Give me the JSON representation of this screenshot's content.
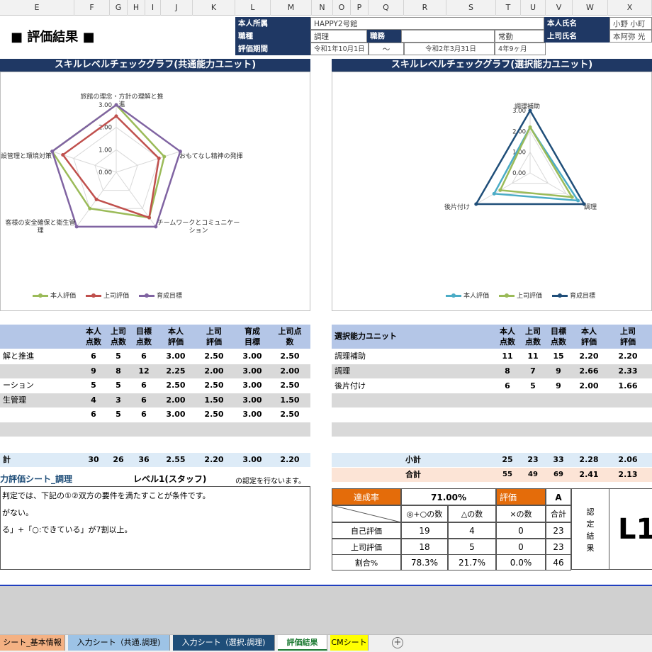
{
  "column_headers": [
    "E",
    "F",
    "G",
    "H",
    "I",
    "J",
    "K",
    "L",
    "M",
    "N",
    "O",
    "P",
    "Q",
    "R",
    "S",
    "T",
    "U",
    "V",
    "W",
    "X"
  ],
  "title": "■ 評価結果 ■",
  "info": {
    "affiliation_label": "本人所属",
    "affiliation_value": "HAPPY2号館",
    "name_label": "本人氏名",
    "name_value": "小野 小町",
    "job_label": "職種",
    "job_value": "調理",
    "duty_label": "職務",
    "duty_value": "",
    "employment_value": "常勤",
    "boss_label": "上司氏名",
    "boss_value": "本阿弥 光",
    "period_label": "評価期間",
    "period_from": "令和1年10月1日",
    "period_sep": "～",
    "period_to": "令和2年3月31日",
    "period_len": "4年9ヶ月"
  },
  "left_chart_banner": "スキルレベルチェックグラフ(共通能力ユニット)",
  "right_chart_banner": "スキルレベルチェックグラフ(選択能力ユニット)",
  "chart_data": [
    {
      "type": "radar",
      "categories": [
        "旅館の理念・方針の理解と推進",
        "おもてなし精神の発揮",
        "チームワークとコミュニケーション",
        "お客様の安全確保と衛生管理",
        "設備管理と環境対策"
      ],
      "category_labels_shown": [
        "旅館の理念・方針の理解と推\n進",
        "おもてなし精神の発揮",
        "チームワークとコミュニケー\nション",
        "客様の安全確保と衛生管\n理",
        "設管理と環境対策"
      ],
      "ticks": [
        "0.00",
        "1.00",
        "2.00",
        "3.00"
      ],
      "rmax": 3,
      "series": [
        {
          "name": "本人評価",
          "color": "#9bbb59",
          "values": [
            3.0,
            2.25,
            2.5,
            2.0,
            3.0
          ]
        },
        {
          "name": "上司評価",
          "color": "#c0504d",
          "values": [
            2.5,
            2.0,
            2.5,
            1.5,
            2.5
          ]
        },
        {
          "name": "育成目標",
          "color": "#8064a2",
          "values": [
            3.0,
            3.0,
            3.0,
            3.0,
            3.0
          ]
        }
      ],
      "extra_lines_color": "#4f81bd"
    },
    {
      "type": "radar",
      "categories": [
        "調理補助",
        "調理",
        "後片付け"
      ],
      "ticks": [
        "0.00",
        "1.00",
        "2.00",
        "3.00"
      ],
      "rmax": 3,
      "series": [
        {
          "name": "本人評価",
          "color": "#4bacc6",
          "values": [
            2.2,
            2.66,
            2.0
          ]
        },
        {
          "name": "上司評価",
          "color": "#9bbb59",
          "values": [
            2.2,
            2.33,
            1.66
          ]
        },
        {
          "name": "育成目標",
          "color": "#1f4e79",
          "values": [
            3.0,
            3.0,
            3.0
          ]
        }
      ]
    }
  ],
  "left_table": {
    "headers": [
      "本人\n点数",
      "上司\n点数",
      "目標\n点数",
      "本人\n評価",
      "上司\n評価",
      "育成\n目標",
      "上司点\n数"
    ],
    "rows": [
      {
        "name": "解と推進",
        "v": [
          "6",
          "5",
          "6",
          "3.00",
          "2.50",
          "3.00",
          "2.50"
        ]
      },
      {
        "name": "",
        "v": [
          "9",
          "8",
          "12",
          "2.25",
          "2.00",
          "3.00",
          "2.00"
        ]
      },
      {
        "name": "ーション",
        "v": [
          "5",
          "5",
          "6",
          "2.50",
          "2.50",
          "3.00",
          "2.50"
        ]
      },
      {
        "name": "生管理",
        "v": [
          "4",
          "3",
          "6",
          "2.00",
          "1.50",
          "3.00",
          "1.50"
        ]
      },
      {
        "name": "",
        "v": [
          "6",
          "5",
          "6",
          "3.00",
          "2.50",
          "3.00",
          "2.50"
        ]
      }
    ],
    "subtotal_label": "計",
    "subtotal": [
      "30",
      "26",
      "36",
      "2.55",
      "2.20",
      "3.00",
      "2.20"
    ]
  },
  "right_table": {
    "title": "選択能力ユニット",
    "headers": [
      "本人\n点数",
      "上司\n点数",
      "目標\n点数",
      "本人\n評価",
      "上司\n評価"
    ],
    "rows": [
      {
        "name": "調理補助",
        "v": [
          "11",
          "11",
          "15",
          "2.20",
          "2.20"
        ]
      },
      {
        "name": "調理",
        "v": [
          "8",
          "7",
          "9",
          "2.66",
          "2.33"
        ]
      },
      {
        "name": "後片付け",
        "v": [
          "6",
          "5",
          "9",
          "2.00",
          "1.66"
        ]
      }
    ],
    "subtotal_label": "小計",
    "subtotal": [
      "25",
      "23",
      "33",
      "2.28",
      "2.06"
    ],
    "total_label": "合計",
    "total": [
      "55",
      "49",
      "69",
      "2.41",
      "2.13"
    ]
  },
  "notes": {
    "sheet_title": "力評価シート_調理",
    "level": "レベル1(スタッフ)",
    "not_cert": "の認定を行ないます。",
    "line1": "判定では、下記の①②双方の要件を満たすことが条件です。",
    "line2": "がない。",
    "line3": "る」+「○:できている」が7割以上。"
  },
  "result": {
    "rate_label": "達成率",
    "rate_value": "71.00%",
    "eval_label": "評価",
    "eval_value": "A",
    "col_headers": [
      "◎+○の数",
      "△の数",
      "×の数",
      "合計"
    ],
    "rows": [
      {
        "label": "自己評価",
        "v": [
          "19",
          "4",
          "0",
          "23"
        ]
      },
      {
        "label": "上司評価",
        "v": [
          "18",
          "5",
          "0",
          "23"
        ]
      },
      {
        "label": "割合%",
        "v": [
          "78.3%",
          "21.7%",
          "0.0%",
          "46"
        ]
      }
    ],
    "cert_label": "認\n定\n結\n果",
    "cert_value": "L1"
  },
  "tabs": [
    {
      "label": "シート_基本情報",
      "color": "#f4b183"
    },
    {
      "label": "入力シート（共通.調理)",
      "color": "#9dc3e6"
    },
    {
      "label": "入力シート（選択.調理)",
      "color": "#1f4e79"
    },
    {
      "label": "評価結果",
      "color": "#ffffff"
    },
    {
      "label": "CMシート",
      "color": "#ffff00"
    }
  ],
  "add_sheet_icon": "plus-circle-icon"
}
